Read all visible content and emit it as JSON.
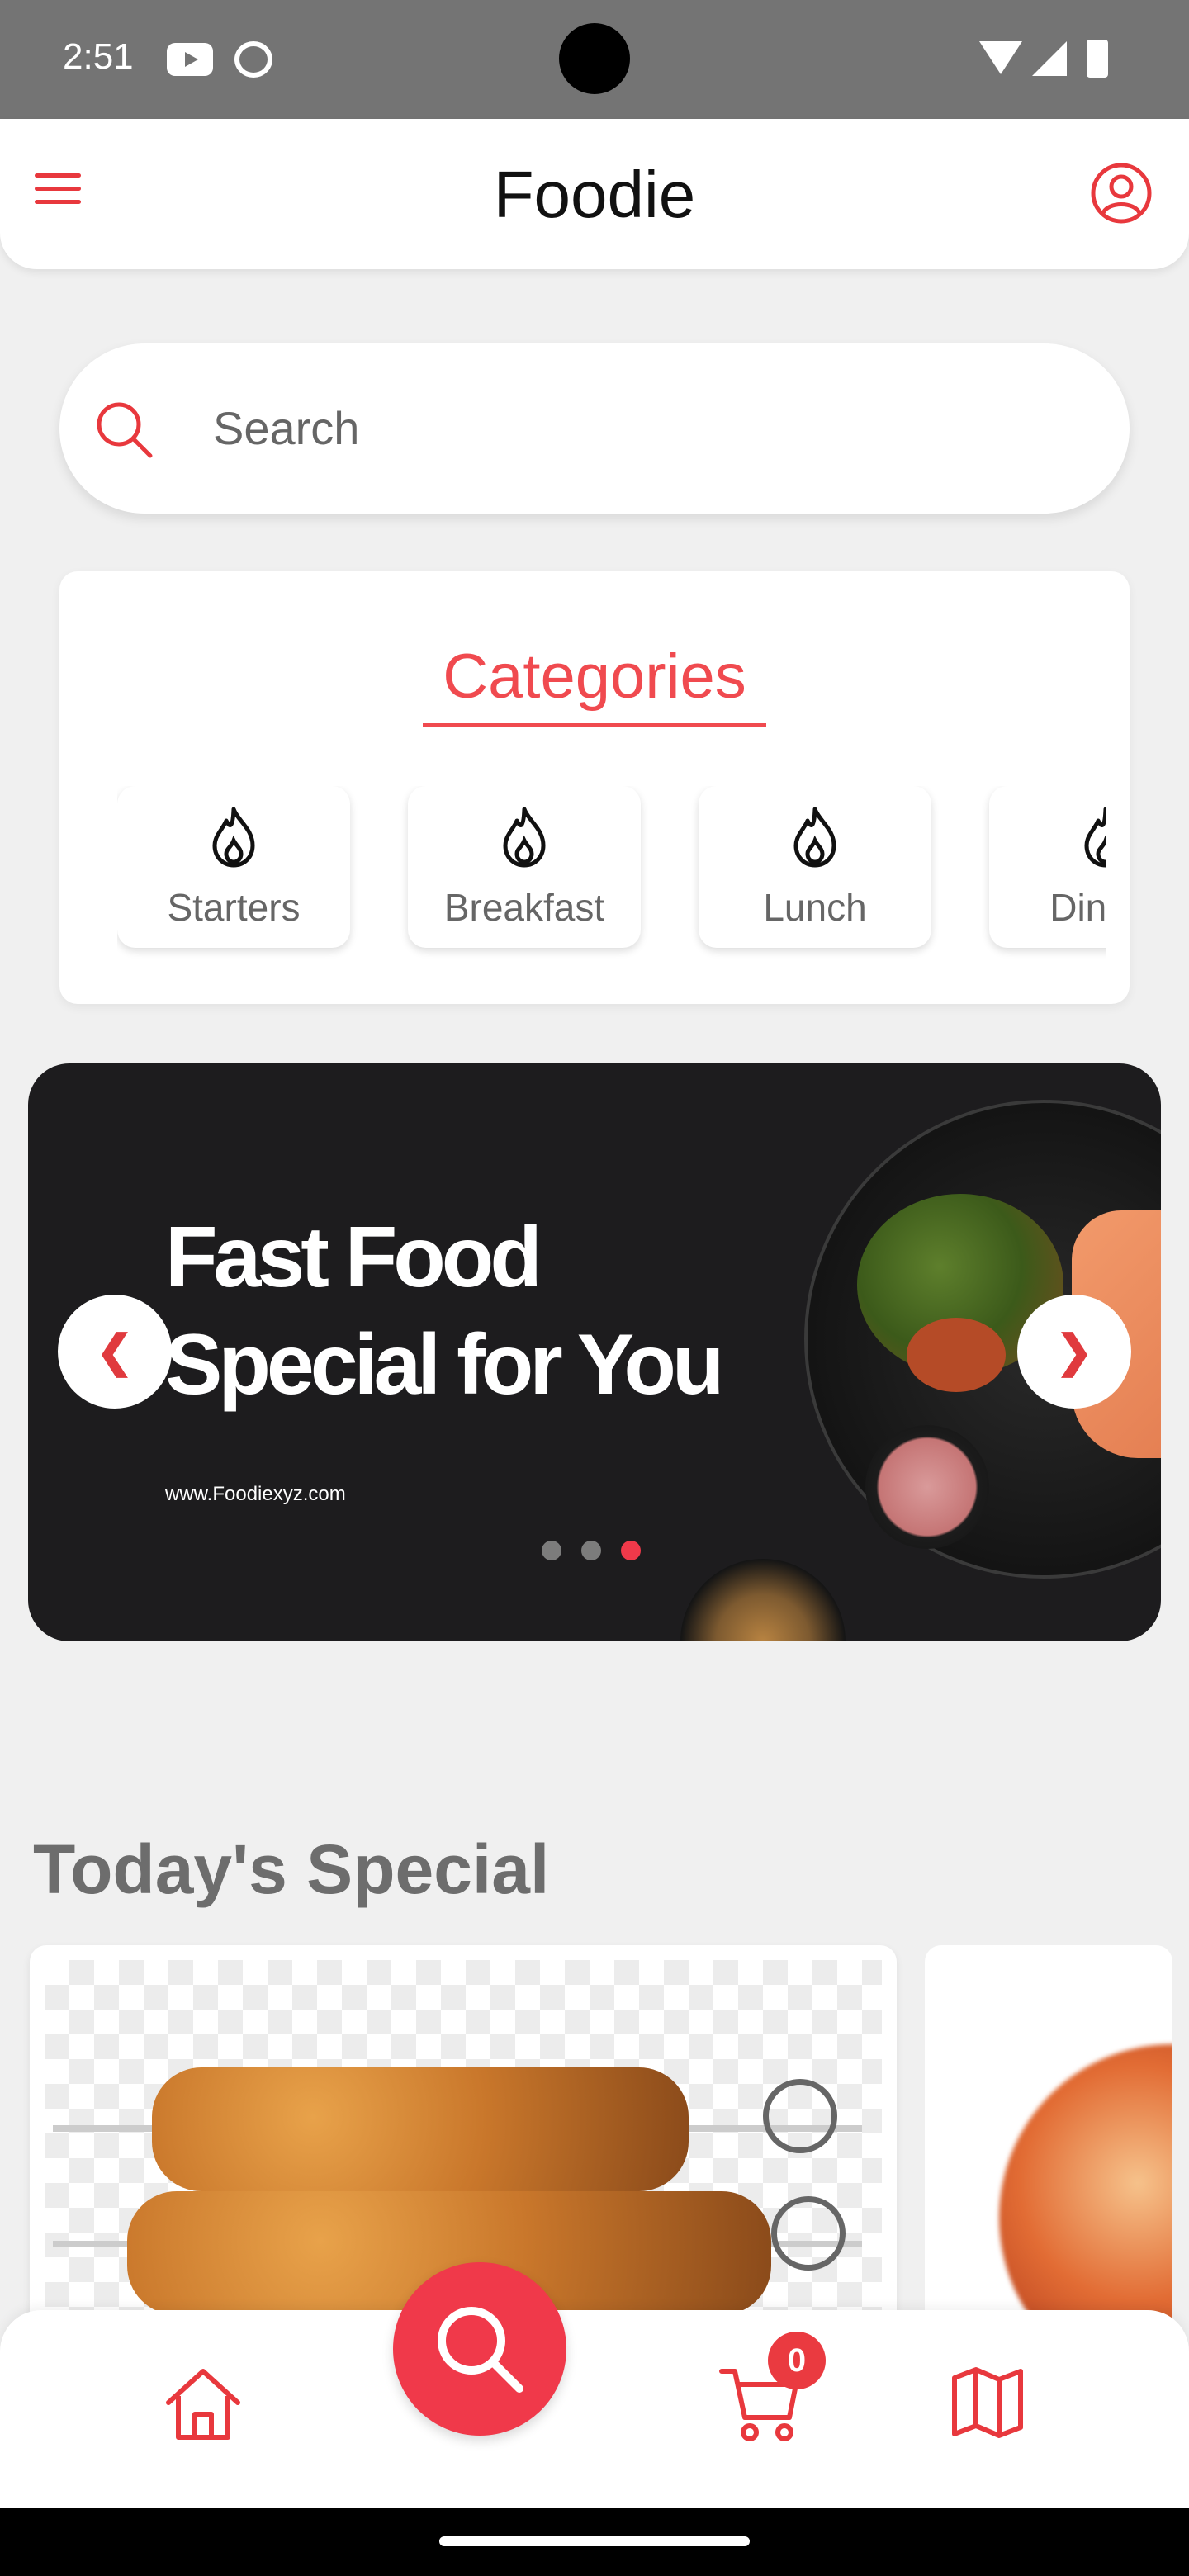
{
  "status_bar": {
    "time": "2:51"
  },
  "app_bar": {
    "title": "Foodie"
  },
  "search": {
    "placeholder": "Search"
  },
  "categories": {
    "title": "Categories",
    "items": [
      {
        "label": "Starters",
        "icon": "fire-icon"
      },
      {
        "label": "Breakfast",
        "icon": "fire-icon"
      },
      {
        "label": "Lunch",
        "icon": "fire-icon"
      },
      {
        "label": "Dinner",
        "icon": "fire-icon"
      }
    ]
  },
  "banner": {
    "headline_line1": "Fast Food",
    "headline_line2": "Special for You",
    "url": "www.Foodiexyz.com",
    "prev_label": "❮",
    "next_label": "❯",
    "slide_count": 3,
    "active_slide": 3
  },
  "todays_special": {
    "title": "Today's Special"
  },
  "bottom_nav": {
    "cart_count": "0"
  },
  "colors": {
    "accent": "#f0394a",
    "banner_bg": "#1d1c1e",
    "page_bg": "#f0f0f0"
  }
}
